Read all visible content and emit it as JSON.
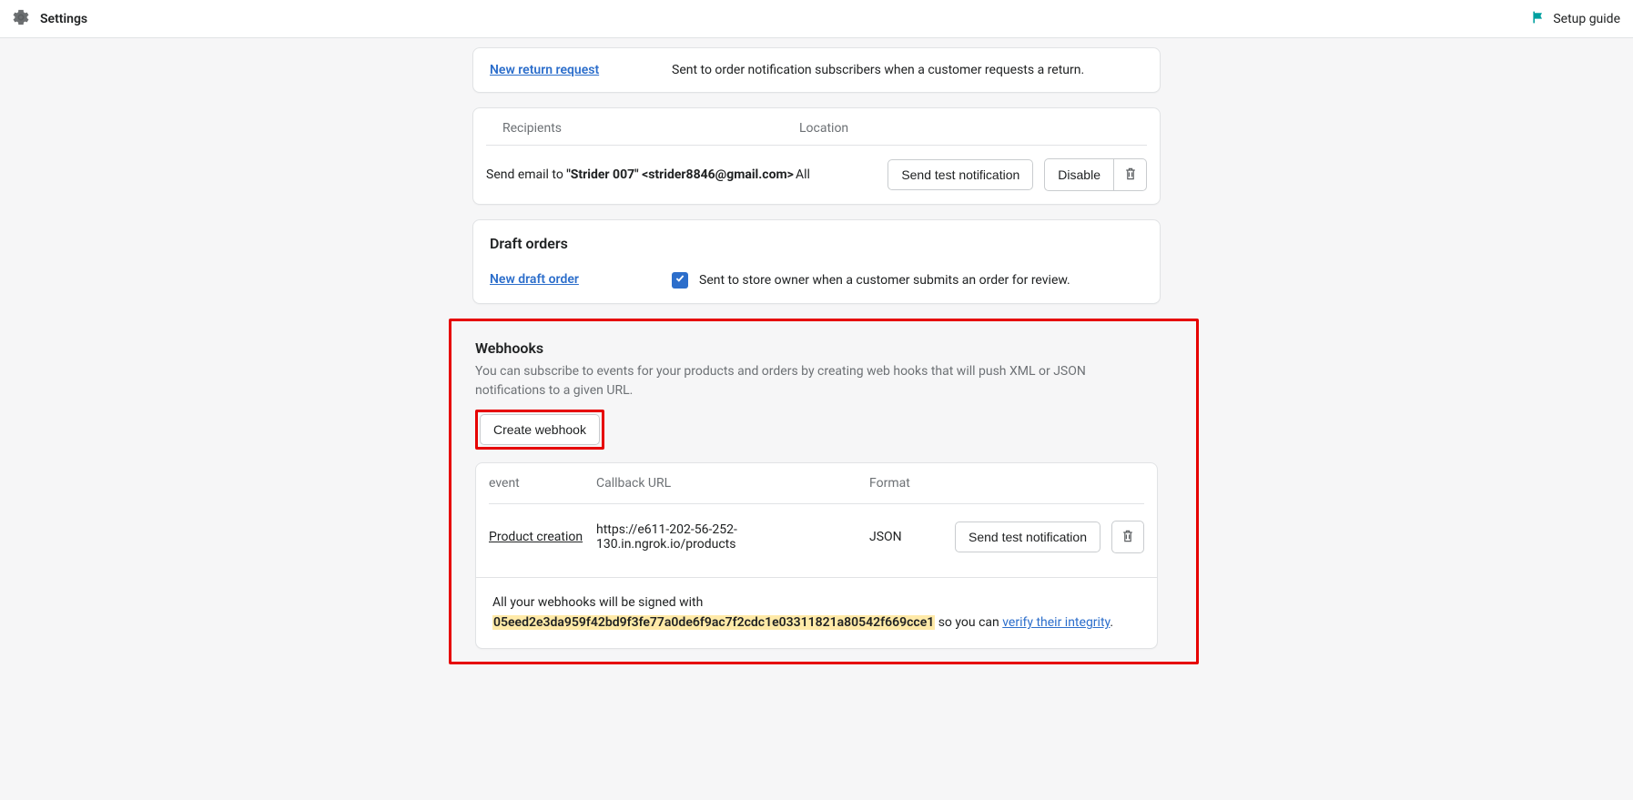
{
  "topbar": {
    "title": "Settings",
    "setup_guide": "Setup guide"
  },
  "return_card": {
    "link_label": "New return request",
    "description": "Sent to order notification subscribers when a customer requests a return."
  },
  "recipients_card": {
    "headers": {
      "recipients": "Recipients",
      "location": "Location"
    },
    "row": {
      "prefix": "Send email to ",
      "recipient": "\"Strider 007\" <strider8846@gmail.com>",
      "location": "All",
      "send_test_label": "Send test notification",
      "disable_label": "Disable"
    }
  },
  "draft_orders": {
    "title": "Draft orders",
    "link_label": "New draft order",
    "description": "Sent to store owner when a customer submits an order for review."
  },
  "webhooks": {
    "title": "Webhooks",
    "description": "You can subscribe to events for your products and orders by creating web hooks that will push XML or JSON notifications to a given URL.",
    "create_label": "Create webhook",
    "headers": {
      "event": "event",
      "url": "Callback URL",
      "format": "Format"
    },
    "row": {
      "event": "Product creation",
      "url": "https://e611-202-56-252-130.in.ngrok.io/products",
      "format": "JSON",
      "send_test_label": "Send test notification"
    },
    "signing": {
      "prefix": "All your webhooks will be signed with ",
      "secret": "05eed2e3da959f42bd9f3fe77a0de6f9ac7f2cdc1e03311821a80542f669cce1",
      "middle": " so you can ",
      "link": "verify their integrity",
      "suffix": "."
    }
  }
}
